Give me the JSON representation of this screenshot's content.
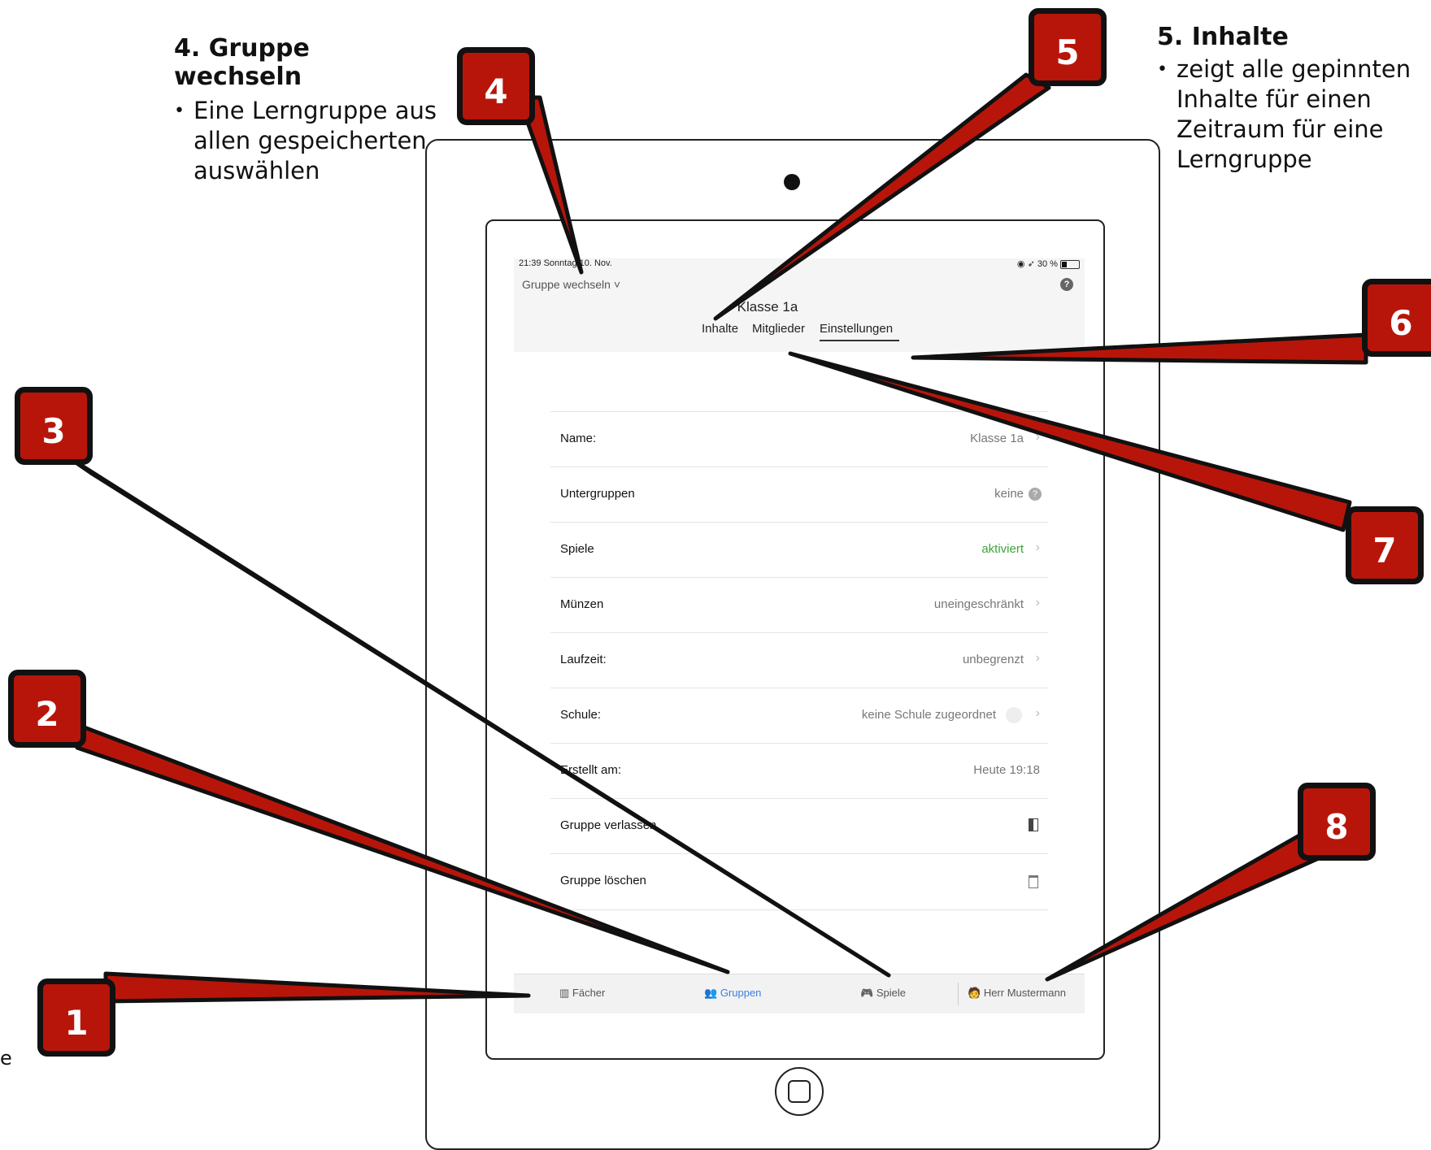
{
  "annotations": {
    "note4": {
      "title": "4. Gruppe wechseln",
      "bullets": [
        "Eine Lerngruppe aus allen gespeicherten auswählen"
      ]
    },
    "note5": {
      "title": "5. Inhalte",
      "bullets": [
        "zeigt alle gepinnten Inhalte für einen Zeitraum für eine Lerngruppe"
      ]
    },
    "cut_text": "e",
    "badges": [
      "1",
      "2",
      "3",
      "4",
      "5",
      "6",
      "7",
      "8"
    ]
  },
  "status_bar": {
    "time_date": "21:39  Sonntag 10. Nov.",
    "battery": "30 %"
  },
  "header": {
    "group_switch": "Gruppe wechseln ˅",
    "help": "?",
    "title": "Klasse 1a",
    "tabs": [
      "Inhalte",
      "Mitglieder",
      "Einstellungen"
    ],
    "active_tab": "Einstellungen"
  },
  "settings": [
    {
      "label": "Name:",
      "value": "Klasse 1a"
    },
    {
      "label": "Untergruppen",
      "value": "keine"
    },
    {
      "label": "Spiele",
      "value": "aktiviert"
    },
    {
      "label": "Münzen",
      "value": "uneingeschränkt"
    },
    {
      "label": "Laufzeit:",
      "value": "unbegrenzt"
    },
    {
      "label": "Schule:",
      "value": "keine Schule zugeordnet"
    },
    {
      "label": "Erstellt am:",
      "value": "Heute 19:18"
    },
    {
      "label": "Gruppe verlassen",
      "value": ""
    },
    {
      "label": "Gruppe löschen",
      "value": ""
    }
  ],
  "tabbar": {
    "items": [
      "Fächer",
      "Gruppen",
      "Spiele",
      "Herr Mustermann"
    ],
    "active": "Gruppen"
  },
  "colors": {
    "badge_red": "#b8150a",
    "active_blue": "#3d7ee0",
    "enabled_green": "#3aa63a"
  }
}
